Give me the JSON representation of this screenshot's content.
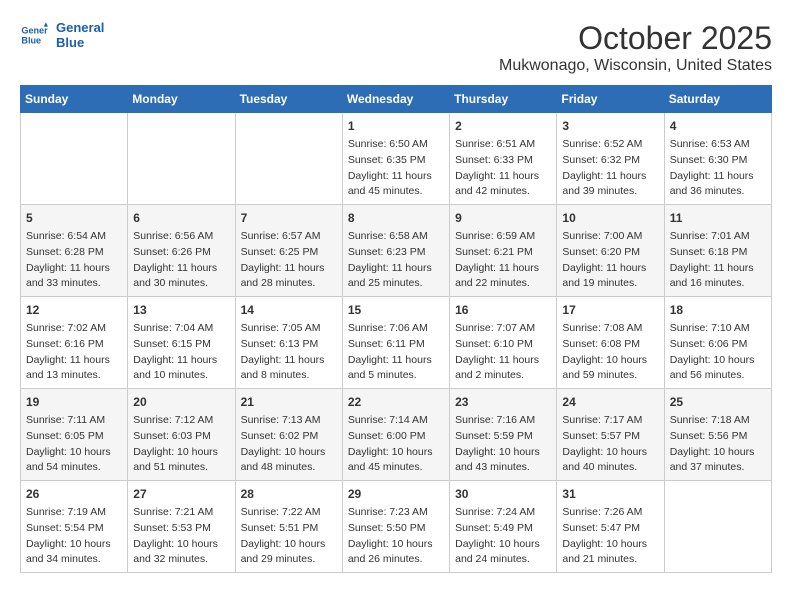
{
  "logo": {
    "line1": "General",
    "line2": "Blue"
  },
  "title": "October 2025",
  "subtitle": "Mukwonago, Wisconsin, United States",
  "weekdays": [
    "Sunday",
    "Monday",
    "Tuesday",
    "Wednesday",
    "Thursday",
    "Friday",
    "Saturday"
  ],
  "weeks": [
    [
      {
        "day": "",
        "info": ""
      },
      {
        "day": "",
        "info": ""
      },
      {
        "day": "",
        "info": ""
      },
      {
        "day": "1",
        "info": "Sunrise: 6:50 AM\nSunset: 6:35 PM\nDaylight: 11 hours and 45 minutes."
      },
      {
        "day": "2",
        "info": "Sunrise: 6:51 AM\nSunset: 6:33 PM\nDaylight: 11 hours and 42 minutes."
      },
      {
        "day": "3",
        "info": "Sunrise: 6:52 AM\nSunset: 6:32 PM\nDaylight: 11 hours and 39 minutes."
      },
      {
        "day": "4",
        "info": "Sunrise: 6:53 AM\nSunset: 6:30 PM\nDaylight: 11 hours and 36 minutes."
      }
    ],
    [
      {
        "day": "5",
        "info": "Sunrise: 6:54 AM\nSunset: 6:28 PM\nDaylight: 11 hours and 33 minutes."
      },
      {
        "day": "6",
        "info": "Sunrise: 6:56 AM\nSunset: 6:26 PM\nDaylight: 11 hours and 30 minutes."
      },
      {
        "day": "7",
        "info": "Sunrise: 6:57 AM\nSunset: 6:25 PM\nDaylight: 11 hours and 28 minutes."
      },
      {
        "day": "8",
        "info": "Sunrise: 6:58 AM\nSunset: 6:23 PM\nDaylight: 11 hours and 25 minutes."
      },
      {
        "day": "9",
        "info": "Sunrise: 6:59 AM\nSunset: 6:21 PM\nDaylight: 11 hours and 22 minutes."
      },
      {
        "day": "10",
        "info": "Sunrise: 7:00 AM\nSunset: 6:20 PM\nDaylight: 11 hours and 19 minutes."
      },
      {
        "day": "11",
        "info": "Sunrise: 7:01 AM\nSunset: 6:18 PM\nDaylight: 11 hours and 16 minutes."
      }
    ],
    [
      {
        "day": "12",
        "info": "Sunrise: 7:02 AM\nSunset: 6:16 PM\nDaylight: 11 hours and 13 minutes."
      },
      {
        "day": "13",
        "info": "Sunrise: 7:04 AM\nSunset: 6:15 PM\nDaylight: 11 hours and 10 minutes."
      },
      {
        "day": "14",
        "info": "Sunrise: 7:05 AM\nSunset: 6:13 PM\nDaylight: 11 hours and 8 minutes."
      },
      {
        "day": "15",
        "info": "Sunrise: 7:06 AM\nSunset: 6:11 PM\nDaylight: 11 hours and 5 minutes."
      },
      {
        "day": "16",
        "info": "Sunrise: 7:07 AM\nSunset: 6:10 PM\nDaylight: 11 hours and 2 minutes."
      },
      {
        "day": "17",
        "info": "Sunrise: 7:08 AM\nSunset: 6:08 PM\nDaylight: 10 hours and 59 minutes."
      },
      {
        "day": "18",
        "info": "Sunrise: 7:10 AM\nSunset: 6:06 PM\nDaylight: 10 hours and 56 minutes."
      }
    ],
    [
      {
        "day": "19",
        "info": "Sunrise: 7:11 AM\nSunset: 6:05 PM\nDaylight: 10 hours and 54 minutes."
      },
      {
        "day": "20",
        "info": "Sunrise: 7:12 AM\nSunset: 6:03 PM\nDaylight: 10 hours and 51 minutes."
      },
      {
        "day": "21",
        "info": "Sunrise: 7:13 AM\nSunset: 6:02 PM\nDaylight: 10 hours and 48 minutes."
      },
      {
        "day": "22",
        "info": "Sunrise: 7:14 AM\nSunset: 6:00 PM\nDaylight: 10 hours and 45 minutes."
      },
      {
        "day": "23",
        "info": "Sunrise: 7:16 AM\nSunset: 5:59 PM\nDaylight: 10 hours and 43 minutes."
      },
      {
        "day": "24",
        "info": "Sunrise: 7:17 AM\nSunset: 5:57 PM\nDaylight: 10 hours and 40 minutes."
      },
      {
        "day": "25",
        "info": "Sunrise: 7:18 AM\nSunset: 5:56 PM\nDaylight: 10 hours and 37 minutes."
      }
    ],
    [
      {
        "day": "26",
        "info": "Sunrise: 7:19 AM\nSunset: 5:54 PM\nDaylight: 10 hours and 34 minutes."
      },
      {
        "day": "27",
        "info": "Sunrise: 7:21 AM\nSunset: 5:53 PM\nDaylight: 10 hours and 32 minutes."
      },
      {
        "day": "28",
        "info": "Sunrise: 7:22 AM\nSunset: 5:51 PM\nDaylight: 10 hours and 29 minutes."
      },
      {
        "day": "29",
        "info": "Sunrise: 7:23 AM\nSunset: 5:50 PM\nDaylight: 10 hours and 26 minutes."
      },
      {
        "day": "30",
        "info": "Sunrise: 7:24 AM\nSunset: 5:49 PM\nDaylight: 10 hours and 24 minutes."
      },
      {
        "day": "31",
        "info": "Sunrise: 7:26 AM\nSunset: 5:47 PM\nDaylight: 10 hours and 21 minutes."
      },
      {
        "day": "",
        "info": ""
      }
    ]
  ]
}
